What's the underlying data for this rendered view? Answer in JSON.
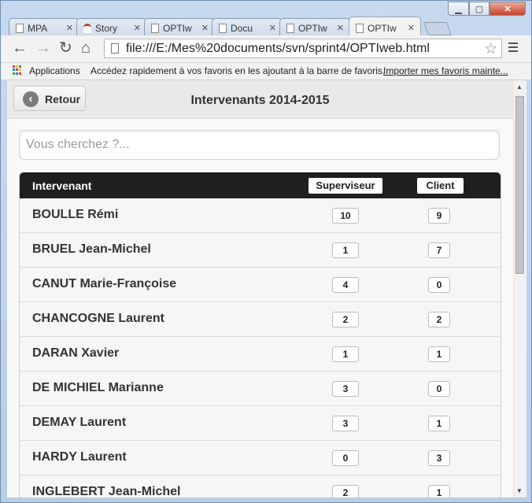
{
  "window": {
    "controls": [
      "minimize-icon",
      "maximize-icon",
      "close-icon"
    ]
  },
  "tabs": [
    {
      "label": "MPA",
      "icon": "page-icon"
    },
    {
      "label": "Story",
      "icon": "story-icon"
    },
    {
      "label": "OPTIw",
      "icon": "page-icon"
    },
    {
      "label": "Docu",
      "icon": "page-icon"
    },
    {
      "label": "OPTIw",
      "icon": "page-icon"
    },
    {
      "label": "OPTIw",
      "icon": "page-icon",
      "active": true
    }
  ],
  "toolbar": {
    "url": "file:///E:/Mes%20documents/svn/sprint4/OPTIweb.html"
  },
  "bookmarks": {
    "apps_label": "Applications",
    "hint": "Accédez rapidement à vos favoris en les ajoutant à la barre de favoris.",
    "import_link": "Importer mes favoris mainte..."
  },
  "page": {
    "back_label": "Retour",
    "title": "Intervenants 2014-2015",
    "search_placeholder": "Vous cherchez ?...",
    "columns": {
      "name": "Intervenant",
      "supervisor": "Superviseur",
      "client": "Client"
    },
    "rows": [
      {
        "name": "BOULLE Rémi",
        "supervisor": "10",
        "client": "9"
      },
      {
        "name": "BRUEL Jean-Michel",
        "supervisor": "1",
        "client": "7"
      },
      {
        "name": "CANUT Marie-Françoise",
        "supervisor": "4",
        "client": "0"
      },
      {
        "name": "CHANCOGNE Laurent",
        "supervisor": "2",
        "client": "2"
      },
      {
        "name": "DARAN Xavier",
        "supervisor": "1",
        "client": "1"
      },
      {
        "name": "DE MICHIEL Marianne",
        "supervisor": "3",
        "client": "0"
      },
      {
        "name": "DEMAY Laurent",
        "supervisor": "3",
        "client": "1"
      },
      {
        "name": "HARDY Laurent",
        "supervisor": "0",
        "client": "3"
      },
      {
        "name": "INGLEBERT Jean-Michel",
        "supervisor": "2",
        "client": "1"
      }
    ]
  },
  "colors": {
    "header_bar": "#1f1f1f",
    "close_button": "#c7432a"
  }
}
